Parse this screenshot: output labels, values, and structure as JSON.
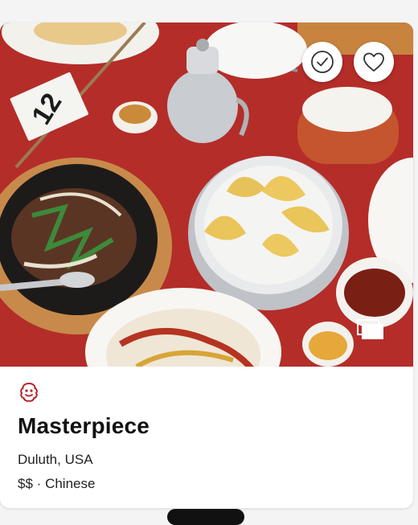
{
  "photo": {
    "table_number": "12",
    "alt_icon": "restaurant-food-photo"
  },
  "actions": {
    "visited_icon": "checkmark-circle-icon",
    "favorite_icon": "heart-outline-icon",
    "gallery_icon": "photo-gallery-icon"
  },
  "restaurant": {
    "award_icon": "michelin-bibendum-icon",
    "name": "Masterpiece",
    "location": "Duluth, USA",
    "price": "$$",
    "separator": "·",
    "cuisine": "Chinese"
  },
  "colors": {
    "accent": "#b5232a",
    "tablecloth": "#b9302c"
  }
}
